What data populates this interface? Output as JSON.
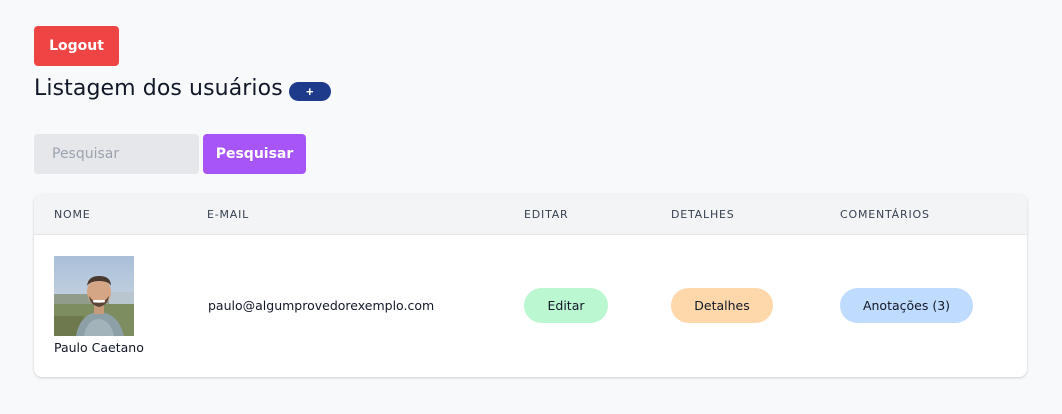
{
  "header": {
    "logout_label": "Logout",
    "title": "Listagem dos usuários",
    "add_label": "+"
  },
  "search": {
    "placeholder": "Pesquisar",
    "value": "",
    "button_label": "Pesquisar"
  },
  "table": {
    "columns": [
      "NOME",
      "E-MAIL",
      "EDITAR",
      "DETALHES",
      "COMENTÁRIOS"
    ],
    "rows": [
      {
        "name": "Paulo Caetano",
        "email": "paulo@algumprovedorexemplo.com",
        "edit_label": "Editar",
        "details_label": "Detalhes",
        "notes_label": "Anotações (3)"
      }
    ]
  },
  "colors": {
    "logout": "#ef4444",
    "add": "#1e3a8a",
    "search_button": "#a855f7",
    "edit": "#bbf7d0",
    "details": "#fed7aa",
    "notes": "#bfdbfe"
  }
}
